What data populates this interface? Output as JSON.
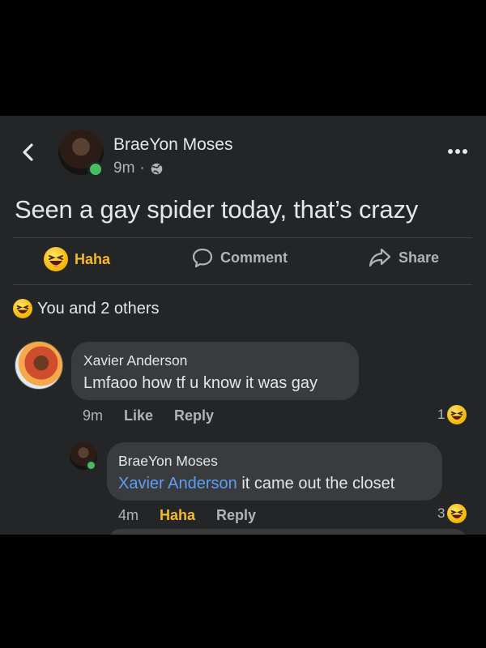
{
  "post": {
    "author": "BraeYon Moses",
    "time": "9m",
    "separator": "·",
    "text": "Seen a gay spider today, that’s crazy"
  },
  "actions": {
    "haha_label": "Haha",
    "comment_label": "Comment",
    "share_label": "Share"
  },
  "reactions": {
    "summary": "You and 2 others"
  },
  "comments": [
    {
      "author": "Xavier Anderson",
      "text": "Lmfaoo how tf u know it was gay",
      "time": "9m",
      "like_label": "Like",
      "reply_label": "Reply",
      "reaction_count": "1"
    }
  ],
  "reply": {
    "author": "BraeYon Moses",
    "tag": "Xavier Anderson",
    "text": " it came out the closet",
    "time": "4m",
    "haha_label": "Haha",
    "reply_label": "Reply",
    "reaction_count": "3"
  },
  "colors": {
    "background": "#242526",
    "bubble": "#3a3b3c",
    "link": "#5e9df6",
    "haha": "#f7b928",
    "online": "#45bd62"
  },
  "icons": [
    "back-icon",
    "globe-icon",
    "more-icon",
    "haha-emoji-icon",
    "comment-icon",
    "share-icon"
  ]
}
